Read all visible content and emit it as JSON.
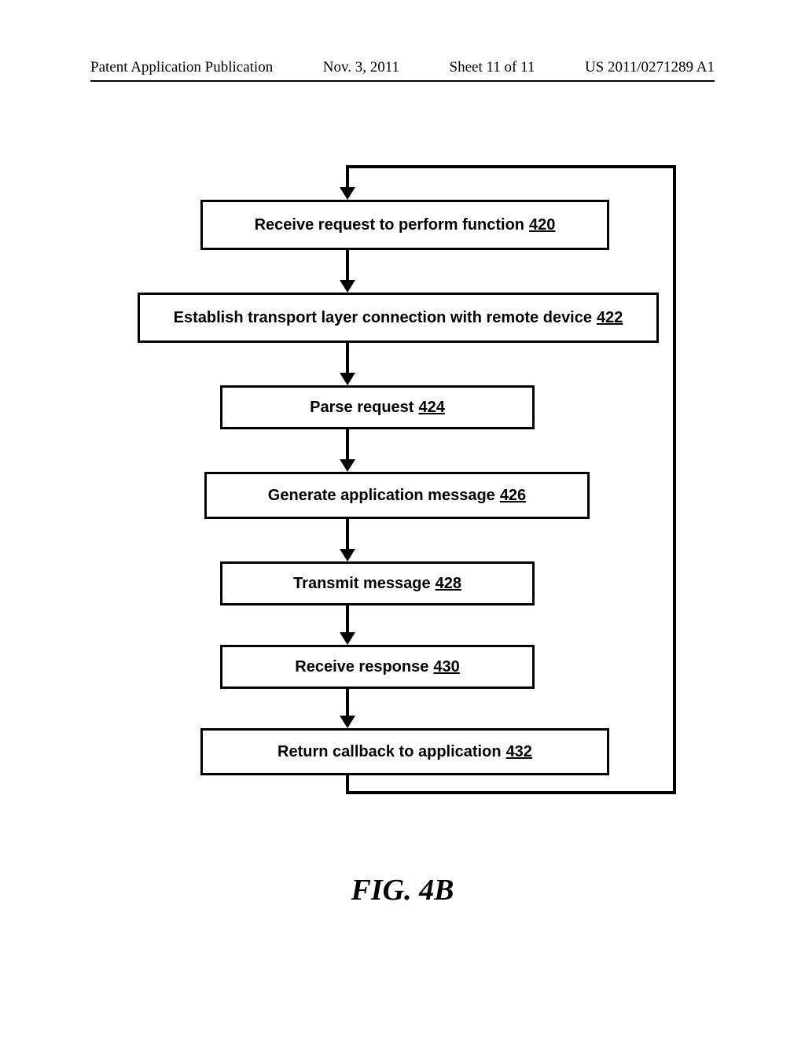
{
  "header": {
    "publication_label": "Patent Application Publication",
    "date": "Nov. 3, 2011",
    "sheet": "Sheet 11 of 11",
    "pub_number": "US 2011/0271289 A1"
  },
  "flowchart": {
    "steps": [
      {
        "text": "Receive request to perform function",
        "ref": "420"
      },
      {
        "text": "Establish transport layer connection with remote device",
        "ref": "422"
      },
      {
        "text": "Parse request",
        "ref": "424"
      },
      {
        "text": "Generate application message",
        "ref": "426"
      },
      {
        "text": "Transmit message",
        "ref": "428"
      },
      {
        "text": "Receive response",
        "ref": "430"
      },
      {
        "text": "Return callback to application",
        "ref": "432"
      }
    ]
  },
  "figure_label": "FIG. 4B"
}
